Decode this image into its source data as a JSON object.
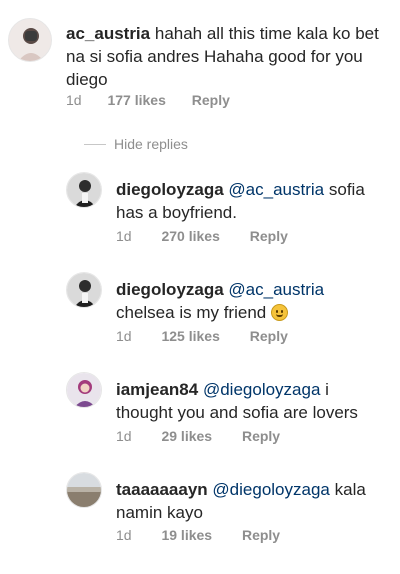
{
  "hide_replies_label": "Hide replies",
  "comments": [
    {
      "username": "ac_austria",
      "mention": "",
      "text": "hahah all this time kala ko bet na si sofia andres Hahaha good for you diego",
      "time": "1d",
      "likes": "177 likes",
      "reply": "Reply"
    },
    {
      "username": "diegoloyzaga",
      "mention": "@ac_austria",
      "text": "sofia has a boyfriend.",
      "time": "1d",
      "likes": "270 likes",
      "reply": "Reply"
    },
    {
      "username": "diegoloyzaga",
      "mention": "@ac_austria",
      "text": "chelsea is my friend",
      "emoji": "slightly-smiling-face-emoji",
      "time": "1d",
      "likes": "125 likes",
      "reply": "Reply"
    },
    {
      "username": "iamjean84",
      "mention": "@diegoloyzaga",
      "text": "i thought you and sofia are lovers",
      "time": "1d",
      "likes": "29 likes",
      "reply": "Reply"
    },
    {
      "username": "taaaaaaayn",
      "mention": "@diegoloyzaga",
      "text": "kala namin kayo",
      "time": "1d",
      "likes": "19 likes",
      "reply": "Reply"
    }
  ]
}
